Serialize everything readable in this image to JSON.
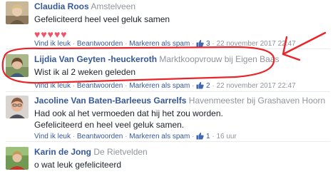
{
  "comments": [
    {
      "author": "Claudia Roos",
      "subtitle": "Amstelveen",
      "text_lines": [
        "Gefeliciteerd heel veel geluk samen"
      ],
      "hearts": "♥♥♥♥♥",
      "actions": {
        "like": "Vind ik leuk",
        "reply": "Beantwoorden",
        "spam": "Markeren als spam",
        "likes": "3",
        "time": "22 november 2017 22:47"
      }
    },
    {
      "author": "Lijdia Van Geyten -heuckeroth",
      "subtitle": "Marktkoopvrouw bij Eigen Baas",
      "text_lines": [
        "Wist ik al 2 weken geleden"
      ],
      "actions": {
        "like": "Vind ik leuk",
        "reply": "Beantwoorden",
        "spam": "Markeren als spam",
        "likes": "2",
        "time": "22 november 2017 22:47"
      }
    },
    {
      "author": "Jacoline Van Baten-Barleeus Garrelfs",
      "subtitle": "Havenmeester bij Grashaven Hoorn",
      "text_lines": [
        "Had ook al het vermoeden dat hij het zou worden.",
        "Gefeliciteerd en heel veel geluk samen."
      ],
      "actions": {
        "like": "Vind ik leuk",
        "reply": "Beantwoorden",
        "spam": "Markeren als spam",
        "likes": "1",
        "time": "16 uur"
      }
    },
    {
      "author": "Karin de Jong",
      "subtitle": "De Rietvelden",
      "text_lines": [
        "o wat leuk gefeliciteerd"
      ]
    }
  ],
  "separators": {
    "dot": "·",
    "dash": "-"
  },
  "colors": {
    "link": "#365899",
    "meta": "#90949c",
    "heart": "#f25268",
    "like_icon": "#4267b2",
    "annotation": "#e8252a"
  }
}
